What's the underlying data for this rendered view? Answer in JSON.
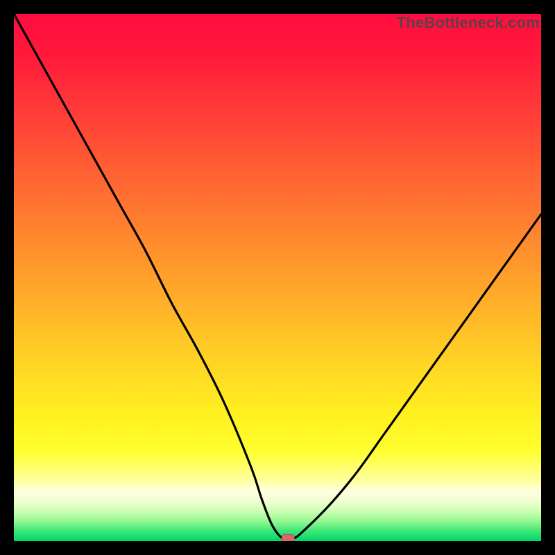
{
  "watermark": "TheBottleneck.com",
  "chart_data": {
    "type": "line",
    "title": "",
    "xlabel": "",
    "ylabel": "",
    "xlim": [
      0,
      100
    ],
    "ylim": [
      0,
      100
    ],
    "grid": false,
    "x": [
      0,
      5,
      10,
      15,
      20,
      25,
      30,
      35,
      40,
      45,
      47,
      49,
      51,
      53,
      55,
      60,
      65,
      70,
      75,
      80,
      85,
      90,
      95,
      100
    ],
    "y": [
      100,
      91,
      82,
      73,
      64,
      55,
      45,
      36,
      26,
      14,
      8,
      3,
      0.5,
      0.5,
      2,
      7,
      13,
      20,
      27,
      34,
      41,
      48,
      55,
      62
    ],
    "marker": {
      "x": 52,
      "y": 0.5,
      "color": "#d46a6a"
    },
    "legend": false
  },
  "gradient_stops": [
    {
      "offset": 0.0,
      "color": "#ff0c3e"
    },
    {
      "offset": 0.08,
      "color": "#ff1a3c"
    },
    {
      "offset": 0.18,
      "color": "#ff3a38"
    },
    {
      "offset": 0.28,
      "color": "#ff5a34"
    },
    {
      "offset": 0.38,
      "color": "#ff7a30"
    },
    {
      "offset": 0.48,
      "color": "#ff9a2c"
    },
    {
      "offset": 0.58,
      "color": "#ffba28"
    },
    {
      "offset": 0.68,
      "color": "#ffda24"
    },
    {
      "offset": 0.76,
      "color": "#fff020"
    },
    {
      "offset": 0.83,
      "color": "#ffff30"
    },
    {
      "offset": 0.885,
      "color": "#ffffa0"
    },
    {
      "offset": 0.905,
      "color": "#ffffe0"
    },
    {
      "offset": 0.925,
      "color": "#f0ffd0"
    },
    {
      "offset": 0.945,
      "color": "#c8ffb0"
    },
    {
      "offset": 0.963,
      "color": "#90f890"
    },
    {
      "offset": 0.98,
      "color": "#40e878"
    },
    {
      "offset": 1.0,
      "color": "#00d66a"
    }
  ]
}
